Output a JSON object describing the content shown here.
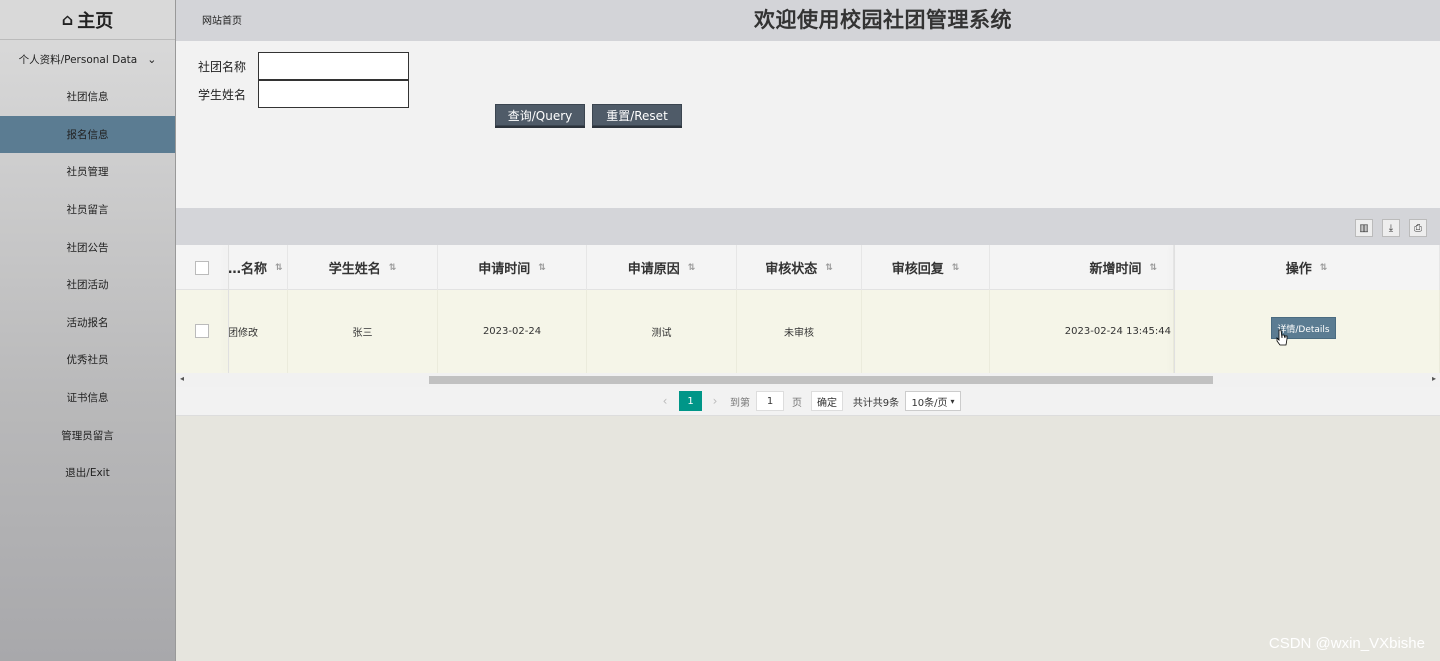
{
  "sidebar": {
    "brand": "主页",
    "home_icon": "⌂",
    "items": [
      {
        "label": "个人资料/Personal Data"
      },
      {
        "label": "社团信息"
      },
      {
        "label": "报名信息"
      },
      {
        "label": "社员管理"
      },
      {
        "label": "社员留言"
      },
      {
        "label": "社团公告"
      },
      {
        "label": "社团活动"
      },
      {
        "label": "活动报名"
      },
      {
        "label": "优秀社员"
      },
      {
        "label": "证书信息"
      },
      {
        "label": "管理员留言"
      },
      {
        "label": "退出/Exit"
      }
    ],
    "active_index": 2
  },
  "header": {
    "home_link": "网站首页",
    "title": "欢迎使用校园社团管理系统"
  },
  "search": {
    "fields": [
      {
        "label": "社团名称",
        "value": ""
      },
      {
        "label": "学生姓名",
        "value": ""
      }
    ],
    "query_button": "查询/Query",
    "reset_button": "重置/Reset"
  },
  "table": {
    "columns": [
      "…名称",
      "学生姓名",
      "申请时间",
      "申请原因",
      "审核状态",
      "审核回复",
      "新增时间",
      "操作"
    ],
    "rows": [
      {
        "club": "团修改",
        "student": "张三",
        "apply_time": "2023-02-24",
        "reason": "测试",
        "status": "未审核",
        "reply": "",
        "created": "2023-02-24 13:45:44",
        "action": "详情/Details"
      }
    ]
  },
  "pager": {
    "current": "1",
    "goto_label": "到第",
    "goto_value": "1",
    "page_unit": "页",
    "confirm": "确定",
    "total": "共计共9条",
    "page_size": "10条/页"
  },
  "watermark": "CSDN @wxin_VXbishe",
  "colors": {
    "accent_active": "#5b7c92",
    "button_dark": "#4f5b68",
    "pager_active": "#009688"
  }
}
